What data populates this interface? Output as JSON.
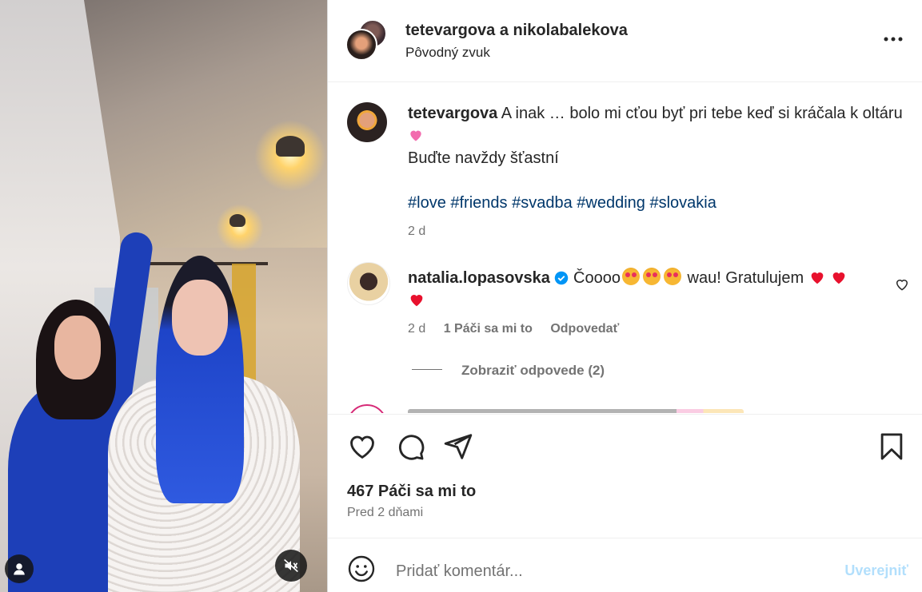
{
  "media": {
    "mute_icon": "speaker-muted-icon",
    "user_icon": "person-icon"
  },
  "header": {
    "owner_primary": "tetevargova",
    "owner_joiner": "a",
    "owner_secondary": "nikolabalekova",
    "audio_label": "Pôvodný zvuk",
    "more_icon": "more-horizontal-icon"
  },
  "caption": {
    "username": "tetevargova",
    "text_line1": "A inak … bolo mi cťou byť pri tebe keď si kráčala k oltáru",
    "text_line2": "Buďte navždy šťastní",
    "hashtags": [
      "#love",
      "#friends",
      "#svadba",
      "#wedding",
      "#slovakia"
    ],
    "age": "2 d"
  },
  "comment": {
    "username": "natalia.lopasovska",
    "text_start": "Čoooo",
    "text_mid": "wau! Gratulujem",
    "age": "2 d",
    "likes": "1 Páči sa mi to",
    "reply": "Odpovedať",
    "view_replies": "Zobraziť odpovede (2)"
  },
  "actions": {
    "like_icon": "heart-icon",
    "comment_icon": "comment-icon",
    "share_icon": "send-icon",
    "save_icon": "bookmark-icon",
    "likes_count": "467 Páči sa mi to",
    "posted": "Pred 2 dňami"
  },
  "composer": {
    "placeholder": "Pridať komentár...",
    "post_label": "Uverejniť",
    "emoji_icon": "smiley-icon"
  },
  "colors": {
    "link": "#00376b",
    "muted": "#737373",
    "post_disabled": "#b2dffc",
    "verified": "#0095f6"
  }
}
